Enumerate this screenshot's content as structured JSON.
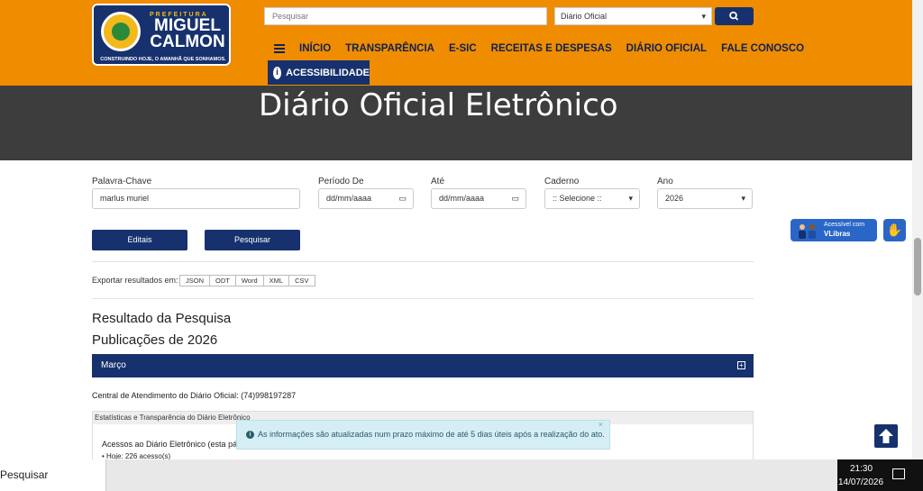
{
  "header": {
    "logo": {
      "prefix": "PREFEITURA",
      "name": "MIGUEL CALMON",
      "slogan": "CONSTRUINDO HOJE, O AMANHÃ QUE SONHAMOS."
    },
    "search": {
      "placeholder": "Pesquisar",
      "select_value": "Diário Oficial"
    },
    "nav": [
      "INÍCIO",
      "TRANSPARÊNCIA",
      "E-SIC",
      "RECEITAS E DESPESAS",
      "DIÁRIO OFICIAL",
      "FALE CONOSCO"
    ],
    "accessibility_label": "ACESSIBILIDADE"
  },
  "banner": {
    "title": "Diário Oficial Eletrônico"
  },
  "form": {
    "keyword": {
      "label": "Palavra-Chave",
      "value": "marlus muriel"
    },
    "period_from": {
      "label": "Período De",
      "value": "dd/mm/aaaa"
    },
    "period_to": {
      "label": "Até",
      "value": "dd/mm/aaaa"
    },
    "caderno": {
      "label": "Caderno",
      "value": ":: Selecione ::"
    },
    "ano": {
      "label": "Ano",
      "value": "2026"
    },
    "editais_label": "Editais",
    "search_label": "Pesquisar"
  },
  "export": {
    "label": "Exportar resultados em:",
    "formats": [
      "JSON",
      "ODT",
      "Word",
      "XML",
      "CSV"
    ]
  },
  "results": {
    "title": "Resultado da Pesquisa",
    "publications": "Publicações de 2026",
    "month": "Março",
    "central": "Central de Atendimento do Diário Oficial: (74)998197287",
    "stats_header": "Estatísticas e Transparência do Diário Eletrônico",
    "stats_sub": "Acessos ao Diário Eletrônico (esta pá",
    "stats_today": "• Hoje: 226 acesso(s)"
  },
  "toast": {
    "message": "As informações são atualizadas num prazo máximo de até 5 dias úteis após a realização do ato."
  },
  "vlibras": {
    "line1": "Acessível com",
    "line2": "VLibras"
  },
  "taskbar": {
    "search": "Pesquisar",
    "time": "21:30",
    "date": "14/07/2026"
  },
  "colors": {
    "orange": "#f08c00",
    "navy": "#16316d",
    "banner": "#3d3d3d"
  }
}
